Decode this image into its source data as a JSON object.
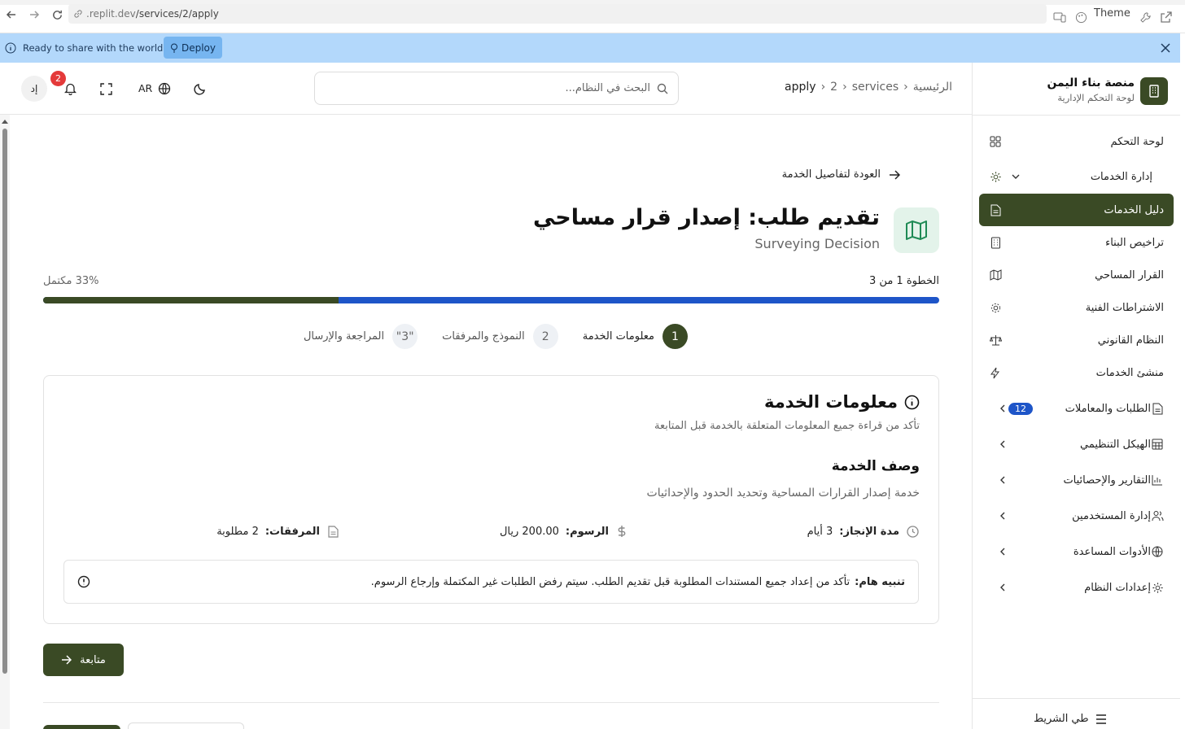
{
  "browser": {
    "url_host": ".replit.dev",
    "url_path": "/services/2/apply",
    "theme_label": "Theme"
  },
  "banner": {
    "text": "Ready to share with the world?",
    "deploy_label": "Deploy"
  },
  "sidebar": {
    "brand_title": "منصة بناء اليمن",
    "brand_subtitle": "لوحة التحكم الإدارية",
    "items": [
      {
        "label": "لوحة التحكم",
        "icon": "grid-icon"
      },
      {
        "label": "إدارة الخدمات",
        "icon": "gear-icon",
        "expanded": true
      },
      {
        "label": "دليل الخدمات",
        "icon": "document-icon",
        "active": true
      },
      {
        "label": "تراخيص البناء",
        "icon": "building-icon"
      },
      {
        "label": "القرار المساحي",
        "icon": "map-icon"
      },
      {
        "label": "الاشتراطات الفنية",
        "icon": "cog-icon"
      },
      {
        "label": "النظام القانوني",
        "icon": "scale-icon"
      },
      {
        "label": "منشئ الخدمات",
        "icon": "bolt-icon"
      },
      {
        "label": "الطلبات والمعاملات",
        "icon": "document-icon",
        "badge": "12"
      },
      {
        "label": "الهيكل التنظيمي",
        "icon": "table-icon"
      },
      {
        "label": "التقارير والإحصائيات",
        "icon": "chart-icon"
      },
      {
        "label": "إدارة المستخدمين",
        "icon": "users-icon"
      },
      {
        "label": "الأدوات المساعدة",
        "icon": "globe-icon"
      },
      {
        "label": "إعدادات النظام",
        "icon": "settings-icon"
      }
    ],
    "collapse_label": "طي الشريط"
  },
  "header": {
    "breadcrumbs": [
      "الرئيسية",
      "services",
      "2",
      "apply"
    ],
    "search_placeholder": "البحث في النظام...",
    "lang": "AR",
    "notifications_count": "2",
    "avatar_initials": "إد"
  },
  "page": {
    "back_label": "العودة لتفاصيل الخدمة",
    "title": "تقديم طلب: إصدار قرار مساحي",
    "subtitle": "Surveying Decision",
    "step_text": "الخطوة 1 من 3",
    "progress_text": "33% مكتمل",
    "progress_fraction": 0.33,
    "steps": [
      {
        "num": "1",
        "label": "معلومات الخدمة",
        "active": true
      },
      {
        "num": "2",
        "label": "النموذج والمرفقات"
      },
      {
        "num": "\"3\"",
        "label": "المراجعة والإرسال"
      }
    ],
    "card": {
      "title": "معلومات الخدمة",
      "subtitle": "تأكد من قراءة جميع المعلومات المتعلقة بالخدمة قبل المتابعة",
      "desc_title": "وصف الخدمة",
      "desc_text": "خدمة إصدار القرارات المساحية وتحديد الحدود والإحداثيات",
      "duration_label": "مدة الإنجاز:",
      "duration_value": "3 أيام",
      "fee_label": "الرسوم:",
      "fee_value": "200.00 ريال",
      "attachments_label": "المرفقات:",
      "attachments_value": "2 مطلوبة",
      "alert_label": "تنبيه هام:",
      "alert_text": "تأكد من إعداد جميع المستندات المطلوبة قبل تقديم الطلب. سيتم رفض الطلبات غير المكتملة وإرجاع الرسوم."
    },
    "continue_label": "متابعة"
  },
  "colors": {
    "primary": "#3a4a25",
    "progress_remaining": "#1e55c8",
    "banner": "#b3d8fb",
    "badge_red": "#e43a3a"
  }
}
